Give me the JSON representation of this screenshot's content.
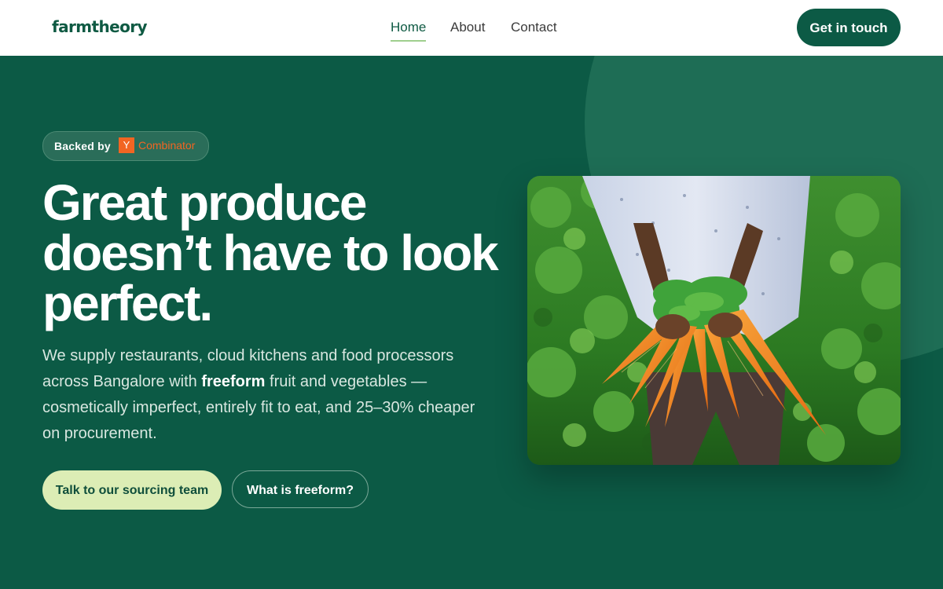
{
  "header": {
    "logo_text": "farmtheory",
    "nav": [
      {
        "label": "Home",
        "active": true
      },
      {
        "label": "About",
        "active": false
      },
      {
        "label": "Contact",
        "active": false
      }
    ],
    "cta_label": "Get in touch"
  },
  "hero": {
    "badge": {
      "prefix": "Backed by",
      "logo_letter": "Y",
      "logo_word": "Combinator"
    },
    "headline": "Great produce doesn’t have to look perfect.",
    "subtext": {
      "before": "We supply restaurants, cloud kitchens and food processors across Bangalore with ",
      "emphasis": "freeform",
      "after": " fruit and vegetables — cosmetically imperfect, entirely fit to eat, and 25–30% cheaper on procurement."
    },
    "primary_button": "Talk to our sourcing team",
    "secondary_button": "What is freeform?",
    "image_icon": "farmer-holding-carrots-photo"
  },
  "colors": {
    "brand_dark_green": "#0c5a45",
    "hero_circle": "#1e6d55",
    "primary_button_bg": "#dcedb5",
    "nav_active_underline": "#9fcf8e",
    "yc_orange": "#f26522"
  }
}
